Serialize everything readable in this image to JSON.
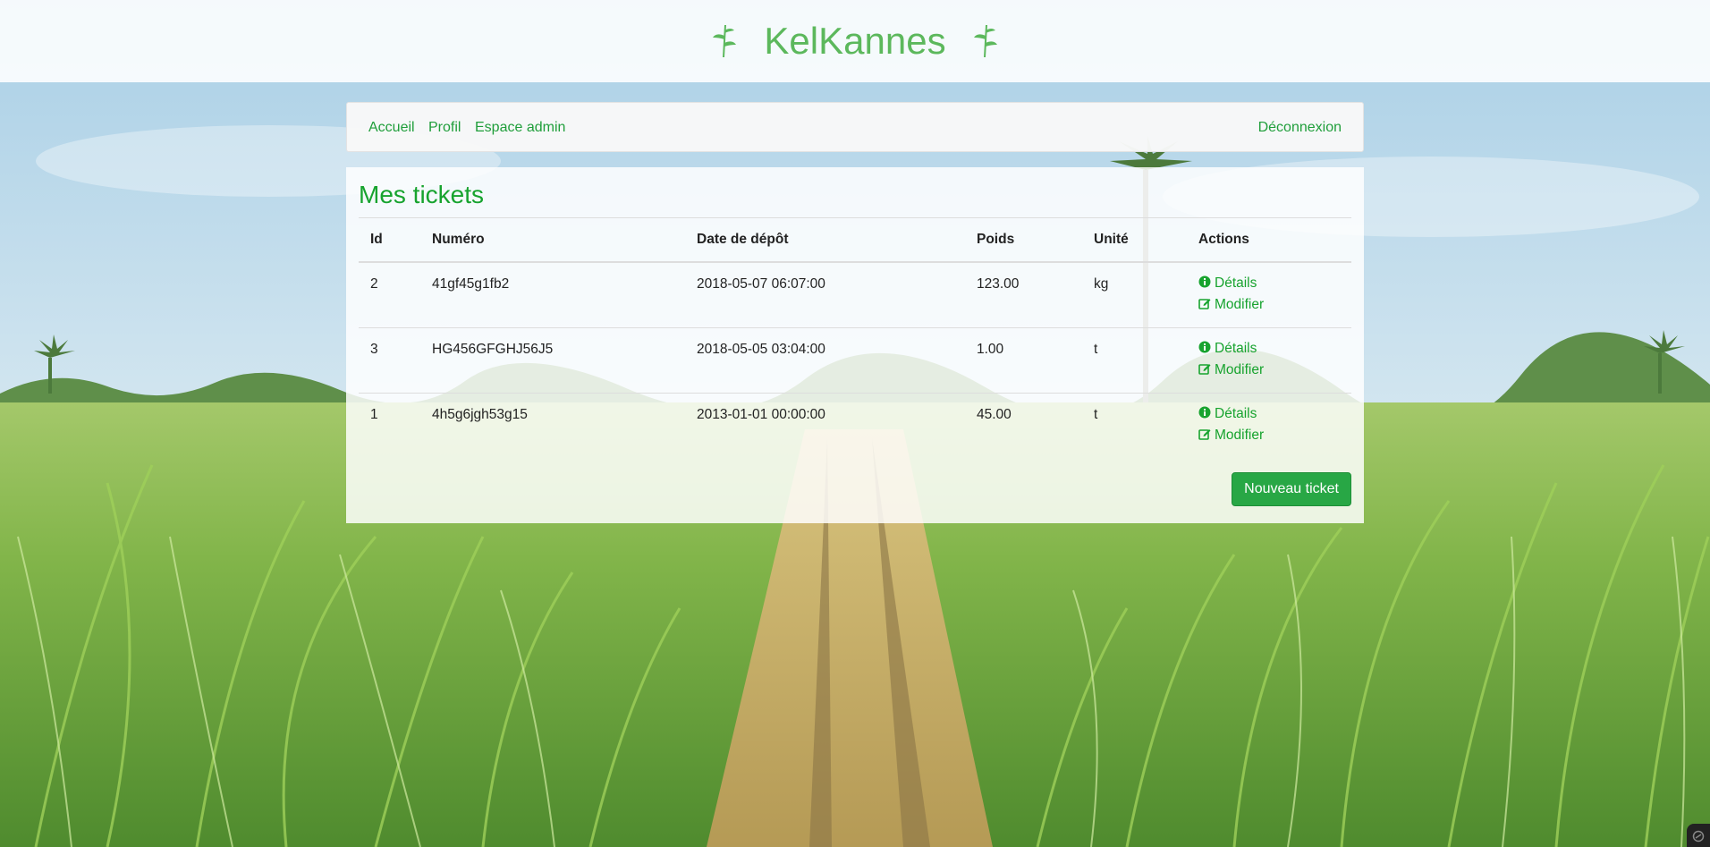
{
  "brand": {
    "name": "KelKannes",
    "color": "#5cb85c"
  },
  "nav": {
    "left_items": [
      {
        "label": "Accueil"
      },
      {
        "label": "Profil"
      },
      {
        "label": "Espace admin"
      }
    ],
    "logout_label": "Déconnexion",
    "link_color": "#1f9e3a"
  },
  "page": {
    "title": "Mes tickets"
  },
  "table": {
    "columns": [
      "Id",
      "Numéro",
      "Date de dépôt",
      "Poids",
      "Unité",
      "Actions"
    ],
    "rows": [
      {
        "id": "2",
        "numero": "41gf45g1fb2",
        "date": "2018-05-07 06:07:00",
        "poids": "123.00",
        "unite": "kg"
      },
      {
        "id": "3",
        "numero": "HG456GFGHJ56J5",
        "date": "2018-05-05 03:04:00",
        "poids": "1.00",
        "unite": "t"
      },
      {
        "id": "1",
        "numero": "4h5g6jgh53g15",
        "date": "2013-01-01 00:00:00",
        "poids": "45.00",
        "unite": "t"
      }
    ],
    "actions": {
      "details_label": "Détails",
      "details_icon": "info-circle-icon",
      "edit_label": "Modifier",
      "edit_icon": "edit-icon"
    }
  },
  "new_ticket_label": "Nouveau ticket",
  "colors": {
    "accent": "#17a32e",
    "button": "#28a745"
  }
}
